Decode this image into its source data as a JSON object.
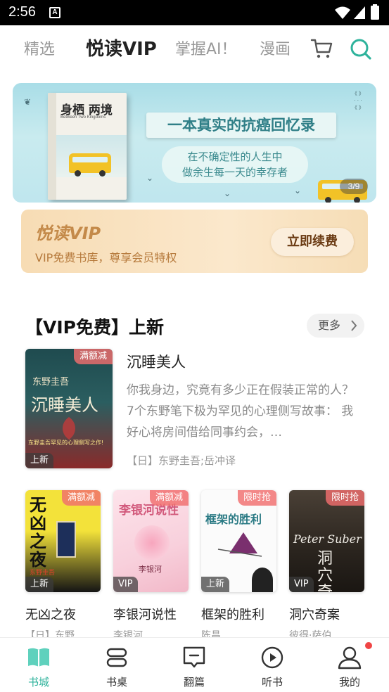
{
  "status_bar": {
    "time": "2:56",
    "a_label": "A"
  },
  "top_tabs": [
    {
      "label": "精选",
      "active": false
    },
    {
      "label": "悦读VIP",
      "active": true
    },
    {
      "label": "掌握AI！",
      "active": false
    },
    {
      "label": "漫画",
      "active": false
    }
  ],
  "banner": {
    "book_title": "身栖 两境",
    "book_subtitle": "Between Two Kingdoms",
    "headline": "一本真实的抗癌回忆录",
    "sub_line1": "在不确定性的人生中",
    "sub_line2": "做余生每一天的幸存者",
    "counter": "3/9"
  },
  "vip_card": {
    "logo": "悦读VIP",
    "description": "VIP免费书库，尊享会员特权",
    "renew_button": "立即续费"
  },
  "section": {
    "title": "【VIP免费】上新",
    "more_label": "更多"
  },
  "featured": {
    "title": "沉睡美人",
    "description": "你我身边，究竟有多少正在假装正常的人？ 7个东野笔下极为罕见的心理侧写故事： 我好心将房间借给同事约会，…",
    "author": "【日】东野圭吾;岳冲译",
    "ribbon": "满额减",
    "tag": "上新",
    "cover_text": "沉睡美人",
    "cover_author": "东野圭吾",
    "cover_note": "东野圭吾罕见的心理侧写之作!"
  },
  "grid": [
    {
      "title": "无凶之夜",
      "author": "【日】东野…",
      "ribbon": "满额减",
      "tag": "上新",
      "cover_text": "无凶之夜",
      "cover_author": "东野圭吾",
      "colors": [
        "#f3e23a",
        "#1a1a1a"
      ]
    },
    {
      "title": "李银河说性",
      "author": "李银河",
      "ribbon": "满额减",
      "tag": "VIP",
      "cover_text": "李银河说性",
      "cover_author": "李银河",
      "colors": [
        "#fbe4e9",
        "#e98aa2"
      ]
    },
    {
      "title": "框架的胜利",
      "author": "陈昌",
      "ribbon": "限时抢",
      "tag": "上新",
      "cover_text": "框架的胜利",
      "cover_author": "",
      "colors": [
        "#fbfbfb",
        "#7a2f6e"
      ]
    },
    {
      "title": "洞穴奇案",
      "author": "彼得·萨伯",
      "ribbon": "限时抢",
      "tag": "VIP",
      "cover_text": "洞穴奇案",
      "cover_author": "Peter Suber",
      "colors": [
        "#3b342c",
        "#1d1915"
      ]
    }
  ],
  "bottom_nav": [
    {
      "label": "书城",
      "icon": "book-open-icon",
      "active": true
    },
    {
      "label": "书桌",
      "icon": "bookshelf-icon",
      "active": false
    },
    {
      "label": "翻篇",
      "icon": "message-icon",
      "active": false
    },
    {
      "label": "听书",
      "icon": "play-circle-icon",
      "active": false
    },
    {
      "label": "我的",
      "icon": "user-icon",
      "active": false,
      "badge": true
    }
  ],
  "colors": {
    "accent": "#2fb39c",
    "tab_highlight": "#6fd9c6",
    "vip_gold": "#c48a4a",
    "ribbon_red": "#f06e6e"
  }
}
